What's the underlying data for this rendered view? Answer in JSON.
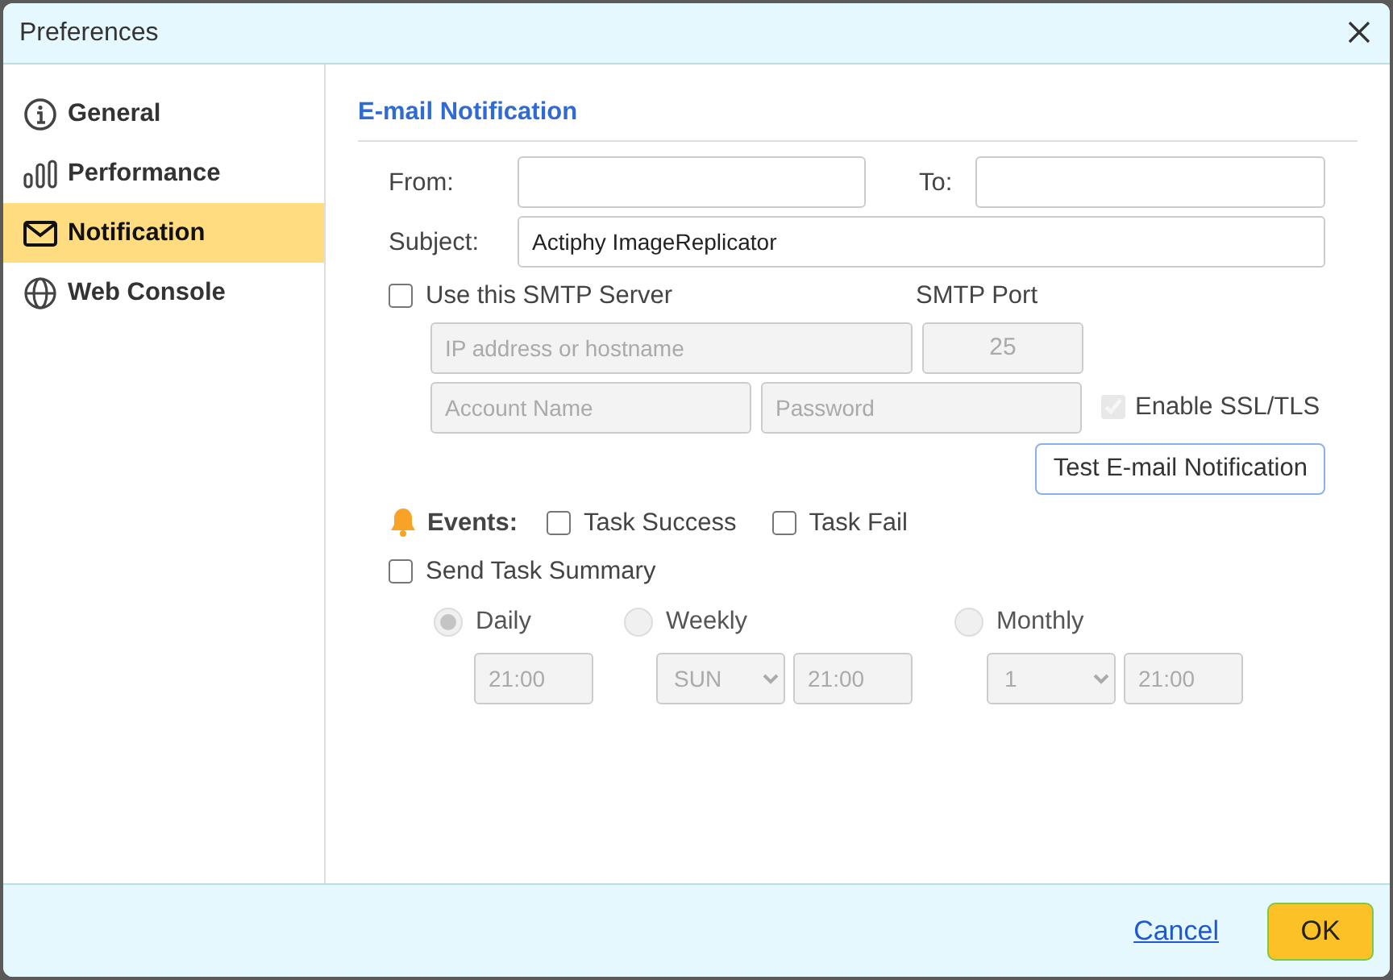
{
  "window": {
    "title": "Preferences"
  },
  "sidebar": {
    "items": [
      {
        "label": "General",
        "kind": "info",
        "selected": false
      },
      {
        "label": "Performance",
        "kind": "bars",
        "selected": false
      },
      {
        "label": "Notification",
        "kind": "mail",
        "selected": true
      },
      {
        "label": "Web Console",
        "kind": "globe",
        "selected": false
      }
    ]
  },
  "section": {
    "title": "E-mail Notification"
  },
  "from": {
    "label": "From:"
  },
  "to": {
    "label": "To:"
  },
  "subject": {
    "label": "Subject:",
    "value": "Actiphy ImageReplicator"
  },
  "smtp": {
    "label": "Use this SMTP Server",
    "checked": false,
    "port_label": "SMTP Port",
    "host_placeholder": "IP address or hostname",
    "port_value": "25",
    "account_placeholder": "Account Name",
    "password_placeholder": "Password",
    "disabled": true
  },
  "ssl": {
    "label": "Enable SSL/TLS",
    "checked": true,
    "disabled": true
  },
  "test_button": "Test E-mail Notification",
  "events": {
    "label": "Events:",
    "items": [
      {
        "label": "Task Success",
        "checked": false
      },
      {
        "label": "Task Fail",
        "checked": false
      }
    ]
  },
  "summary": {
    "label": "Send Task Summary",
    "checked": false,
    "disabled": true,
    "schedules": [
      {
        "kind": "daily",
        "label": "Daily",
        "selected": true,
        "time": "21:00"
      },
      {
        "kind": "weekly",
        "label": "Weekly",
        "selected": false,
        "day": "SUN",
        "time": "21:00"
      },
      {
        "kind": "monthly",
        "label": "Monthly",
        "selected": false,
        "day": "1",
        "time": "21:00"
      }
    ]
  },
  "buttons": {
    "cancel": "Cancel",
    "ok": "OK"
  }
}
